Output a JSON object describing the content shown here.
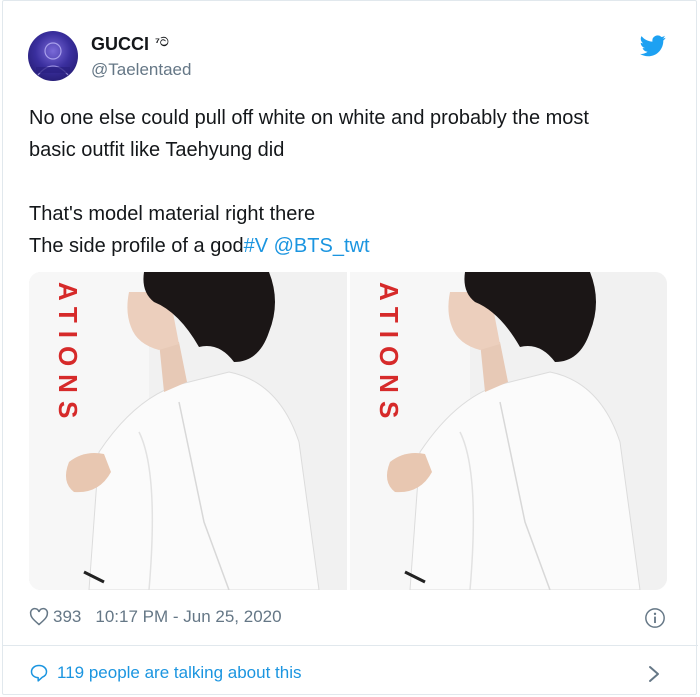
{
  "author": {
    "display_name": "GUCCI",
    "name_suffix": "⁷ට",
    "handle": "@Taelentaed",
    "avatar_icon": "profile-avatar"
  },
  "tweet": {
    "line1": "No one else could pull off white on white and probably the most",
    "line2": "basic outfit like Taehyung did",
    "line3": "That's model material right there",
    "line4_text": "The side profile of a god",
    "hashtag": "#V",
    "mention": "@BTS_twt"
  },
  "media": {
    "photos": [
      {
        "overlay_text": "ATIONS"
      },
      {
        "overlay_text": "ATIONS"
      }
    ]
  },
  "meta": {
    "like_count": "393",
    "timestamp": "10:17 PM - Jun 25, 2020"
  },
  "footer": {
    "talking_text": "119 people are talking about this"
  },
  "colors": {
    "link": "#1b95e0",
    "secondary_text": "#657786",
    "border": "#e1e8ed",
    "overlay_red": "#d62a2a"
  },
  "icons": [
    "twitter-bird-icon",
    "heart-icon",
    "info-icon",
    "speech-bubble-icon",
    "chevron-right-icon"
  ]
}
